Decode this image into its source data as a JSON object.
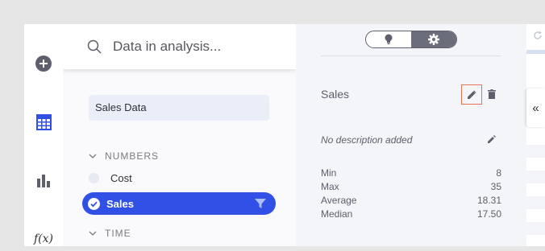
{
  "search": {
    "placeholder": "Data in analysis..."
  },
  "data_table": {
    "name": "Sales Data"
  },
  "groups": [
    {
      "label": "NUMBERS",
      "expanded": true
    },
    {
      "label": "TIME",
      "expanded": true
    }
  ],
  "columns": [
    {
      "name": "Cost",
      "selected": false
    },
    {
      "name": "Sales",
      "selected": true
    }
  ],
  "details": {
    "column_name": "Sales",
    "description": "No description added",
    "stats": [
      {
        "label": "Min",
        "value": "8"
      },
      {
        "label": "Max",
        "value": "35"
      },
      {
        "label": "Average",
        "value": "18.31"
      },
      {
        "label": "Median",
        "value": "17.50"
      }
    ]
  },
  "right_panel": {
    "collapse_label": "«"
  },
  "icons": {
    "add": "plus-circle-icon",
    "table": "grid-table-icon",
    "chart": "bar-chart-icon",
    "formula": "f(x)",
    "search": "search-icon",
    "bulb": "lightbulb-icon",
    "gear": "gear-icon",
    "edit": "pencil-icon",
    "delete": "trash-icon",
    "filter": "funnel-icon",
    "check": "check-circle-icon",
    "chevron": "chevron-down-icon",
    "refresh": "refresh-icon"
  },
  "colors": {
    "accent": "#3050e6",
    "highlight_border": "#e9735a",
    "icon_dark": "#5d606c",
    "rail_icon_blue": "#3050e6"
  }
}
